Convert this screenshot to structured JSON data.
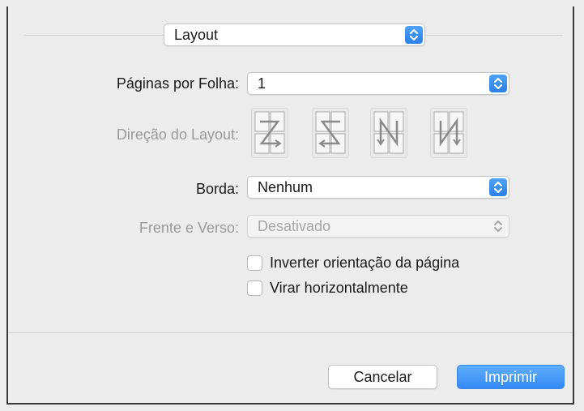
{
  "panel_select": {
    "value": "Layout"
  },
  "pages_per_sheet": {
    "label": "Páginas por Folha:",
    "value": "1"
  },
  "layout_direction": {
    "label": "Direção do Layout:",
    "options": [
      "z-order",
      "reverse-z-order",
      "n-order",
      "reverse-n-order"
    ]
  },
  "border": {
    "label": "Borda:",
    "value": "Nenhum"
  },
  "two_sided": {
    "label": "Frente e Verso:",
    "value": "Desativado"
  },
  "checkboxes": [
    {
      "label": "Inverter orientação da página",
      "checked": false
    },
    {
      "label": "Virar horizontalmente",
      "checked": false
    }
  ],
  "buttons": {
    "cancel": "Cancelar",
    "print": "Imprimir"
  },
  "colors": {
    "accent": "#3589f3",
    "background": "#ececec",
    "disabled_text": "#9a9a9a"
  }
}
